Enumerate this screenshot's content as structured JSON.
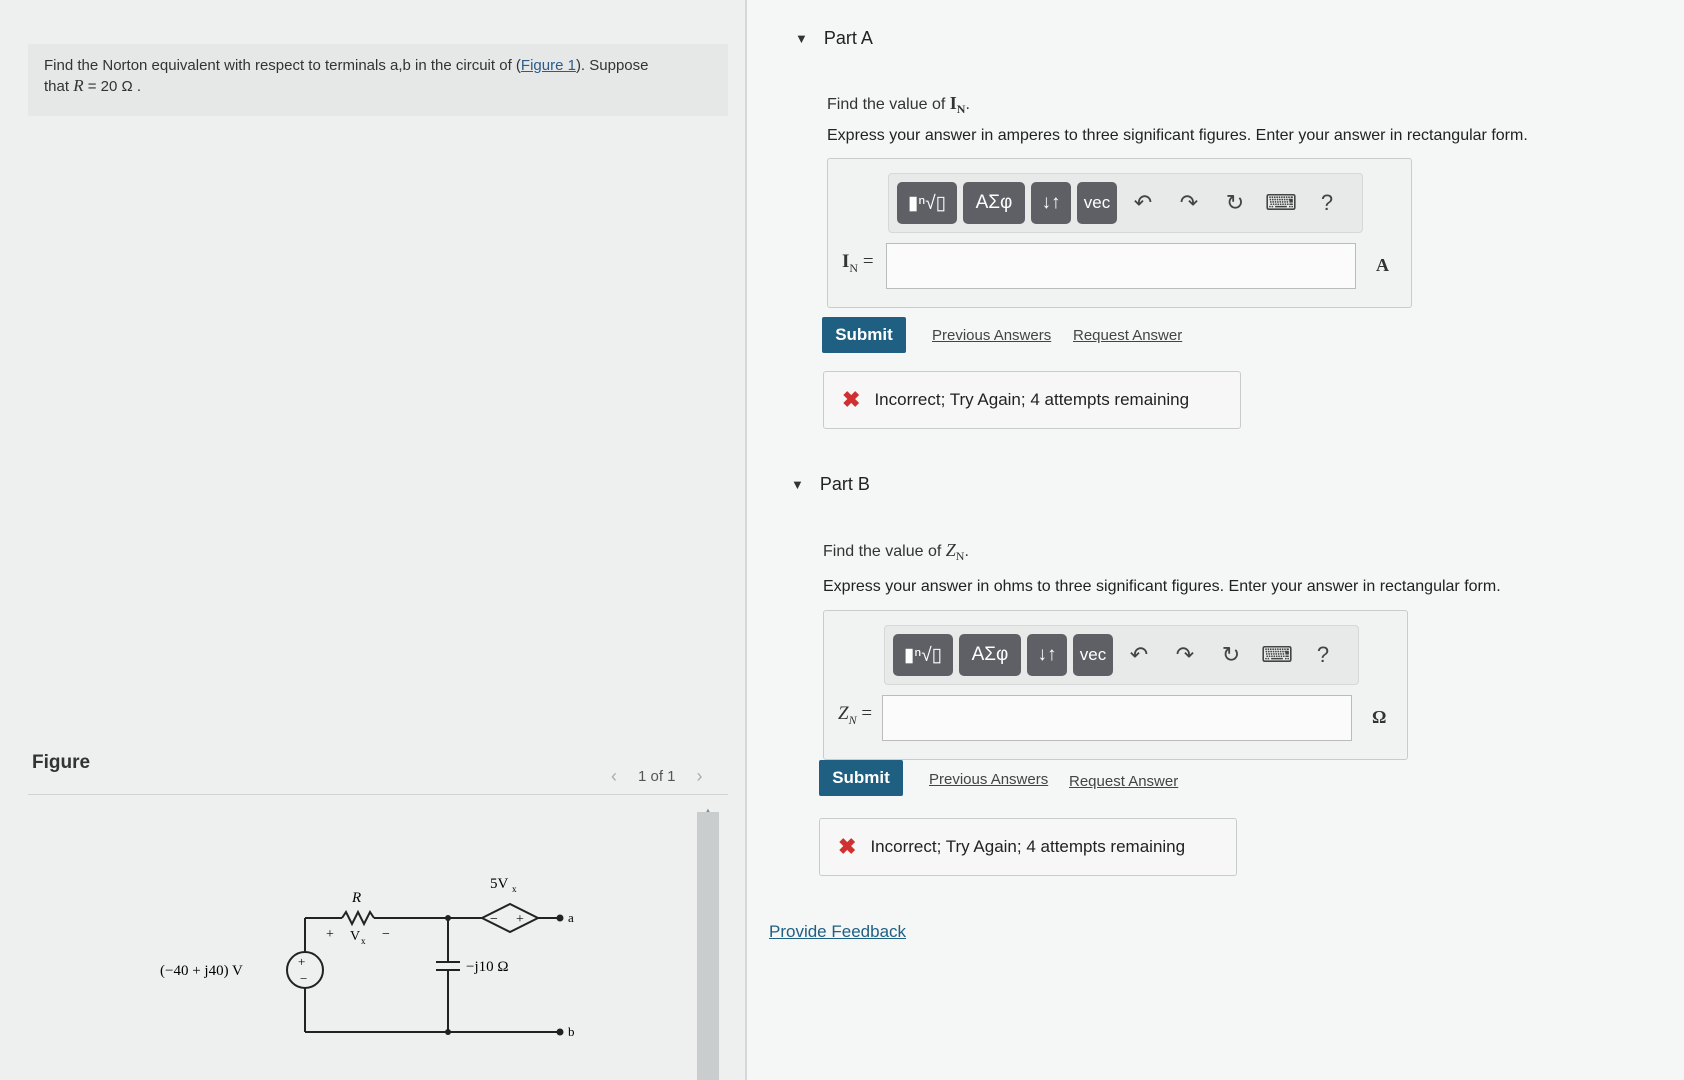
{
  "problem": {
    "text_before_link": "Find the Norton equivalent with respect to terminals a,b in the circuit of (",
    "link_text": "Figure 1",
    "text_after_link": "). Suppose",
    "text_line2_prefix": "that ",
    "r_symbol": "R",
    "r_value": " = 20  Ω ."
  },
  "figure": {
    "heading": "Figure",
    "pager_text": "1 of 1",
    "prev_icon": "chevron-left-icon",
    "next_icon": "chevron-right-icon",
    "circuit": {
      "source_label": "(−40 + j40) V",
      "resistor_label": "R",
      "vx_label": "V",
      "vx_sub": "x",
      "plus_sign": "+",
      "minus_sign": "−",
      "dep_source_label": "5V",
      "dep_source_sub": "x",
      "dep_minus": "−",
      "dep_plus": "+",
      "capacitor_label": "−j10 Ω",
      "terminal_a": "a",
      "terminal_b": "b"
    }
  },
  "partA": {
    "title": "Part A",
    "question_prefix": "Find the value of ",
    "question_var": "I",
    "question_sub": "N",
    "question_suffix": ".",
    "instructions": "Express your answer in amperes to three significant figures. Enter your answer in rectangular form.",
    "input_label": "I",
    "input_label_sub": "N",
    "input_label_eq": " =",
    "input_value": "",
    "unit": "A",
    "submit_label": "Submit",
    "previous_answers": "Previous Answers",
    "request_answer": "Request Answer",
    "feedback": "Incorrect; Try Again; 4 attempts remaining"
  },
  "partB": {
    "title": "Part B",
    "question_prefix": "Find the value of ",
    "question_var": "Z",
    "question_sub": "N",
    "question_suffix": ".",
    "instructions": "Express your answer in ohms to three significant figures. Enter your answer in rectangular form.",
    "input_label": "Z",
    "input_label_sub": "N",
    "input_label_eq": " =",
    "input_value": "",
    "unit": "Ω",
    "submit_label": "Submit",
    "previous_answers": "Previous Answers",
    "request_answer": "Request Answer",
    "feedback": "Incorrect; Try Again; 4 attempts remaining"
  },
  "toolbar": {
    "templates_label": "▮ⁿ√▯",
    "symbols_label": "ΑΣφ",
    "arrows_label": "↓↑",
    "vec_label": "vec",
    "help_label": "?"
  },
  "provide_feedback": "Provide Feedback",
  "colors": {
    "submit_bg": "#1f5f82",
    "toolbar_btn": "#5f5f66",
    "error_x": "#d03030"
  }
}
